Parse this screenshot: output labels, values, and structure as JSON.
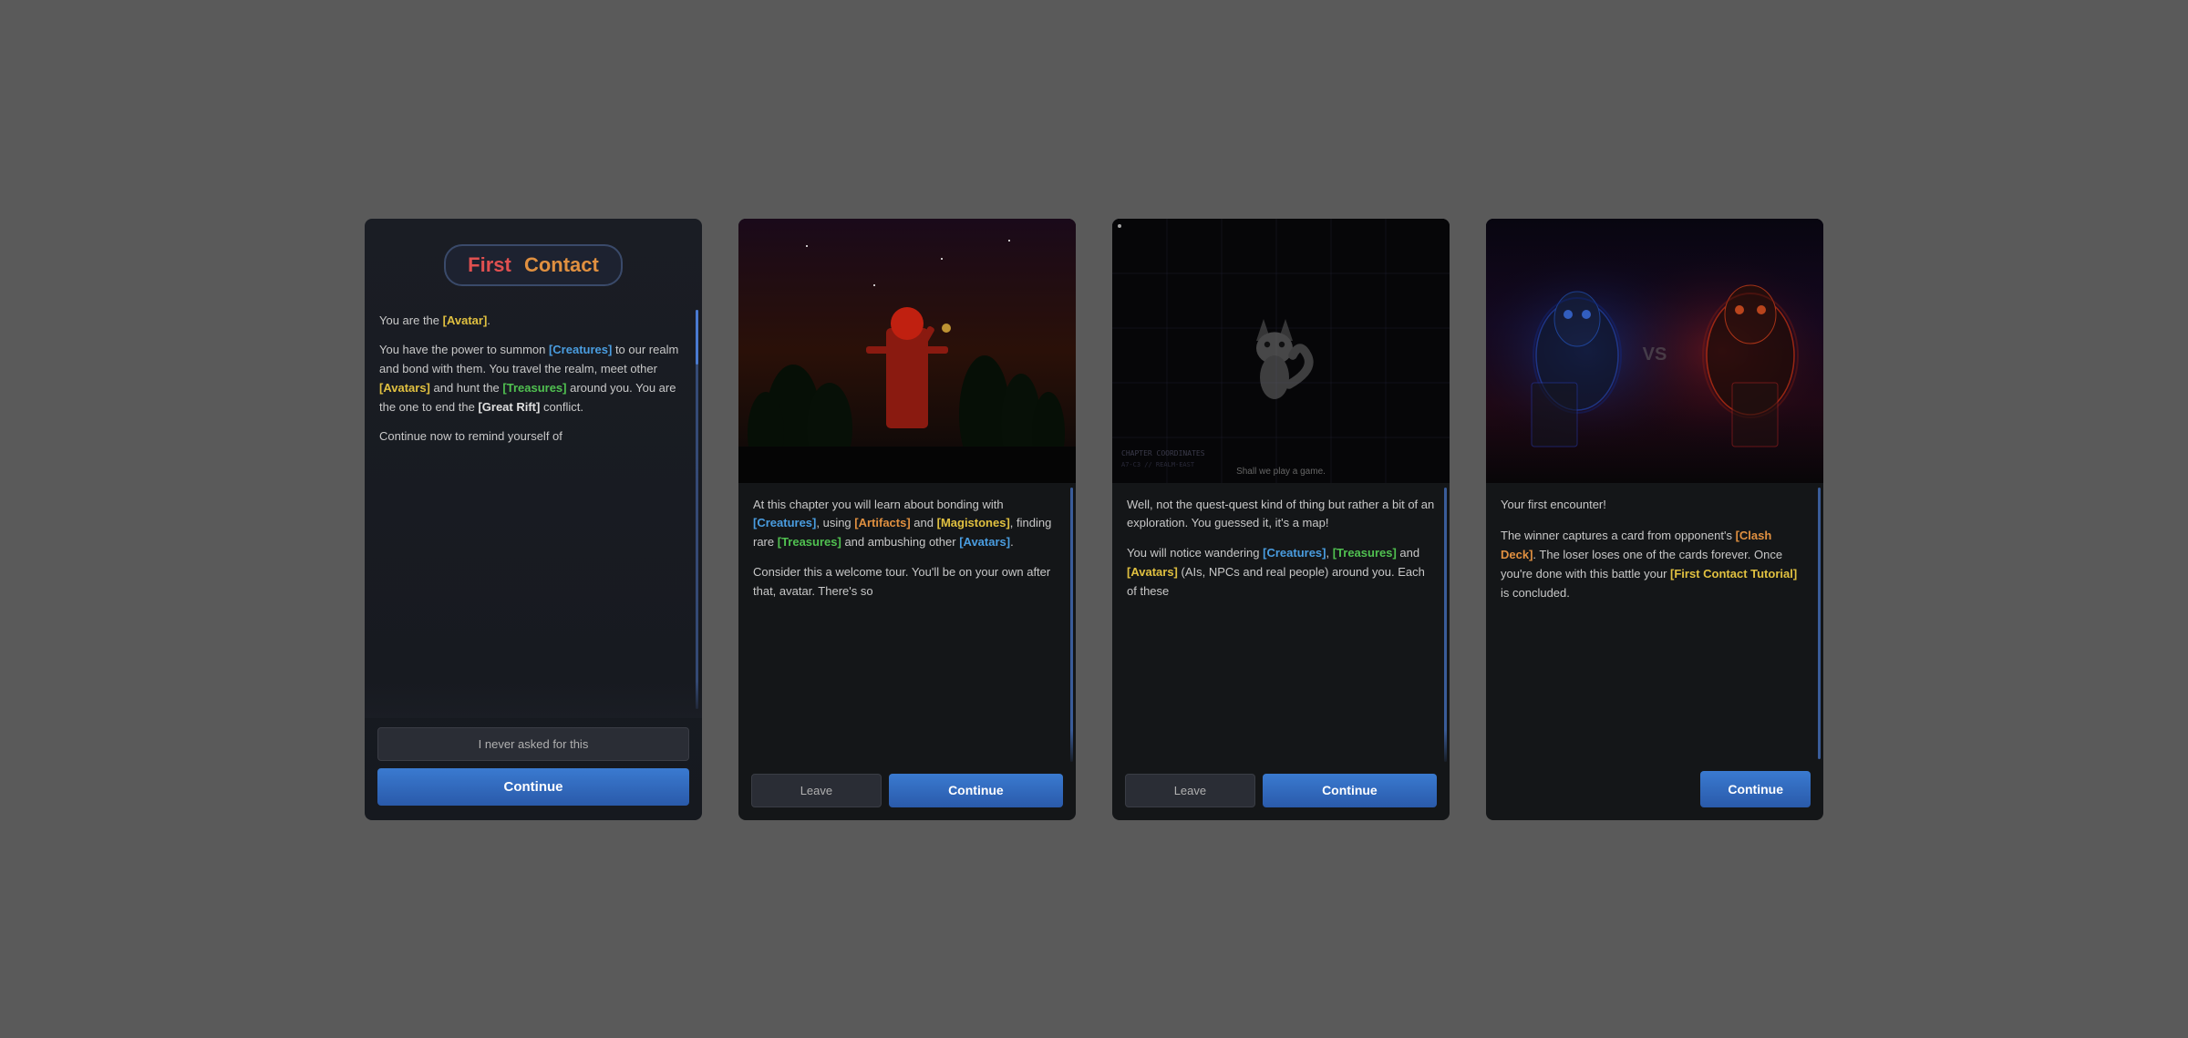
{
  "panels": [
    {
      "id": "panel-1",
      "title": {
        "part1": "First",
        "part1_color": "red",
        "part2": "Contact",
        "part2_color": "orange"
      },
      "content_blocks": [
        {
          "text": "You are the [Avatar].",
          "highlights": [
            {
              "word": "[Avatar]",
              "color": "yellow"
            }
          ]
        },
        {
          "text": "You have the power to summon [Creatures] to our realm and bond with them. You travel the realm, meet other [Avatars] and hunt the [Treasures] around you. You are the one to end the [Great Rift] conflict.",
          "highlights": [
            {
              "word": "[Creatures]",
              "color": "blue"
            },
            {
              "word": "[Avatars]",
              "color": "yellow"
            },
            {
              "word": "[Treasures]",
              "color": "green"
            },
            {
              "word": "[Great Rift]",
              "color": "white-bold"
            }
          ]
        },
        {
          "text": "Continue now to remind yourself of",
          "highlights": []
        }
      ],
      "buttons": [
        {
          "label": "I never asked for this",
          "type": "secondary"
        },
        {
          "label": "Continue",
          "type": "primary"
        }
      ]
    },
    {
      "id": "panel-2",
      "image_type": "forest",
      "content_blocks": [
        {
          "text": "At this chapter you will learn about bonding with [Creatures], using [Artifacts] and [Magistones], finding rare [Treasures] and ambushing other [Avatars].",
          "highlights": [
            {
              "word": "[Creatures]",
              "color": "blue"
            },
            {
              "word": "[Artifacts]",
              "color": "orange"
            },
            {
              "word": "[Magistones]",
              "color": "yellow"
            },
            {
              "word": "[Treasures]",
              "color": "green"
            },
            {
              "word": "[Avatars]",
              "color": "blue"
            }
          ]
        },
        {
          "text": "Consider this a welcome tour. You'll be on your own after that, avatar. There's so",
          "highlights": []
        }
      ],
      "buttons": [
        {
          "label": "Leave",
          "type": "leave"
        },
        {
          "label": "Continue",
          "type": "continue"
        }
      ]
    },
    {
      "id": "panel-3",
      "image_type": "map",
      "image_caption": "Shall we play a game.",
      "image_corner_text": "CHAPTER COORDINATES",
      "content_blocks": [
        {
          "text": "Well, not the quest-quest kind of thing but rather a bit of an exploration. You guessed it, it's a map!",
          "highlights": []
        },
        {
          "text": "You will notice wandering [Creatures], [Treasures] and [Avatars] (AIs, NPCs and real people) around you. Each of these",
          "highlights": [
            {
              "word": "[Creatures]",
              "color": "blue"
            },
            {
              "word": "[Treasures]",
              "color": "green"
            },
            {
              "word": "[Avatars]",
              "color": "yellow"
            }
          ]
        }
      ],
      "buttons": [
        {
          "label": "Leave",
          "type": "leave"
        },
        {
          "label": "Continue",
          "type": "continue"
        }
      ]
    },
    {
      "id": "panel-4",
      "image_type": "battle",
      "content_blocks": [
        {
          "text": "Your first encounter!",
          "highlights": []
        },
        {
          "text": "The winner captures a card from opponent's [Clash Deck]. The loser loses one of the cards forever. Once you're done with this battle your [First Contact Tutorial] is concluded.",
          "highlights": [
            {
              "word": "[Clash Deck]",
              "color": "orange"
            },
            {
              "word": "[First Contact Tutorial]",
              "color": "yellow"
            }
          ]
        }
      ],
      "buttons": [
        {
          "label": "Continue",
          "type": "continue-solo"
        }
      ]
    }
  ]
}
